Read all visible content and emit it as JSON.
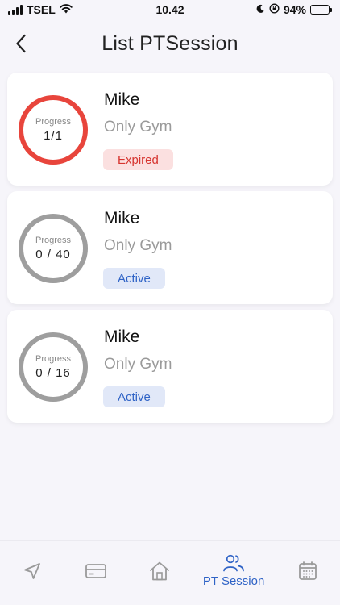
{
  "status_bar": {
    "carrier": "TSEL",
    "time": "10.42",
    "battery": "94%",
    "battery_level": 0.94
  },
  "header": {
    "title": "List PTSession",
    "back_icon": "chevron-left-icon"
  },
  "sessions": [
    {
      "trainer": "Mike",
      "gym": "Only Gym",
      "progress_label": "Progress",
      "progress_value": "1/1",
      "status": "Expired",
      "ring_color": "#e8453c"
    },
    {
      "trainer": "Mike",
      "gym": "Only Gym",
      "progress_label": "Progress",
      "progress_value": "0 / 40",
      "status": "Active",
      "ring_color": "#9e9e9e"
    },
    {
      "trainer": "Mike",
      "gym": "Only Gym",
      "progress_label": "Progress",
      "progress_value": "0 / 16",
      "status": "Active",
      "ring_color": "#9e9e9e"
    }
  ],
  "bottom_nav": {
    "items": [
      {
        "icon": "navigation-arrow-icon",
        "label": ""
      },
      {
        "icon": "card-icon",
        "label": ""
      },
      {
        "icon": "home-icon",
        "label": ""
      },
      {
        "icon": "users-icon",
        "label": "PT Session",
        "active": true
      },
      {
        "icon": "calendar-icon",
        "label": ""
      }
    ]
  },
  "colors": {
    "accent": "#2f63c6",
    "expired": "#e8453c",
    "inactive_icon": "#9a9a9a"
  }
}
